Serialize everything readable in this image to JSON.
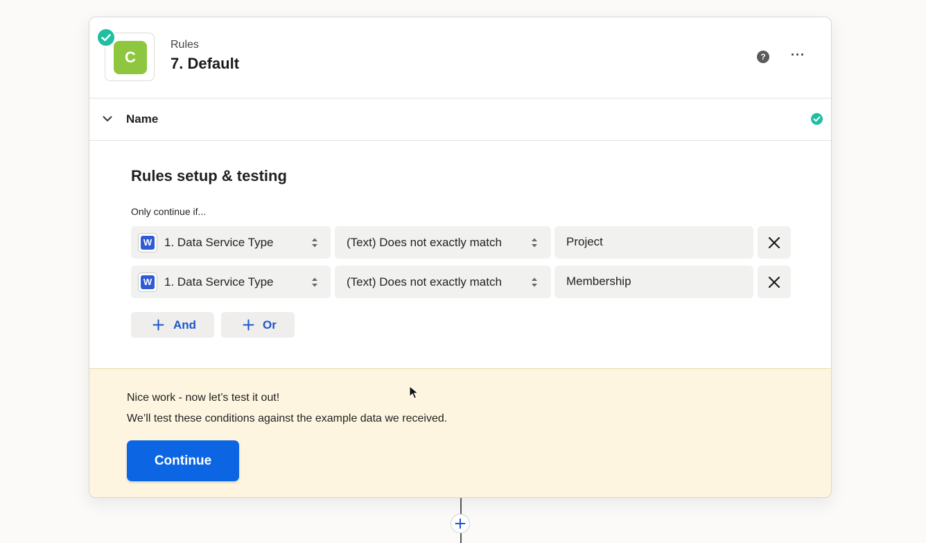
{
  "step": {
    "app_label": "Rules",
    "title": "7. Default",
    "app_logo_letter": "C",
    "logo_color": "#8fc63f",
    "status_color": "#1fbfa2"
  },
  "header_icons": {
    "help": "help-icon",
    "more": "more-icon",
    "more_glyph": "···",
    "help_glyph": "?"
  },
  "name_section": {
    "label": "Name"
  },
  "rules": {
    "title": "Rules setup & testing",
    "condition_label": "Only continue if...",
    "rows": [
      {
        "app_icon_letter": "W",
        "field": "1. Data Service Type",
        "operator": "(Text) Does not exactly match",
        "value": "Project"
      },
      {
        "app_icon_letter": "W",
        "field": "1. Data Service Type",
        "operator": "(Text) Does not exactly match",
        "value": "Membership"
      }
    ],
    "and_label": "And",
    "or_label": "Or"
  },
  "banner": {
    "message_1": "Nice work - now let’s test it out!",
    "message_2": "We’ll test these conditions against the example data we received.",
    "continue_label": "Continue",
    "accent_color": "#0c66e4"
  }
}
